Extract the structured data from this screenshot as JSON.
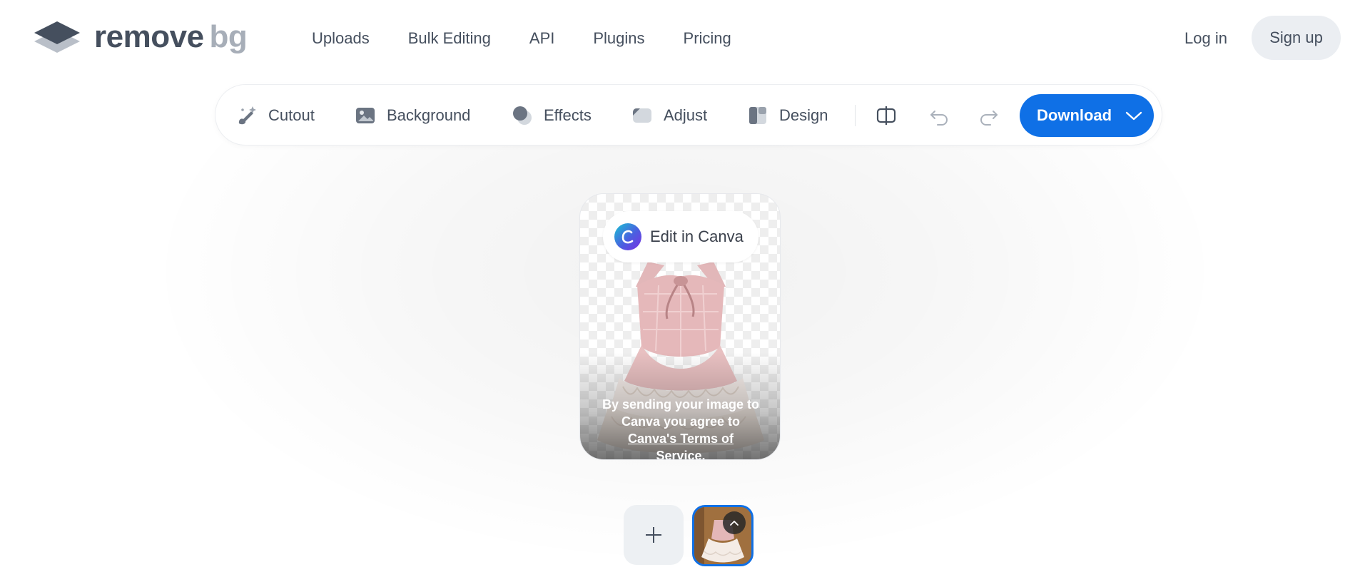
{
  "brand": {
    "word1": "remove",
    "word2": "bg"
  },
  "nav": {
    "items": [
      {
        "label": "Uploads"
      },
      {
        "label": "Bulk Editing"
      },
      {
        "label": "API"
      },
      {
        "label": "Plugins"
      },
      {
        "label": "Pricing"
      }
    ],
    "login_label": "Log in",
    "signup_label": "Sign up"
  },
  "toolbar": {
    "tools": [
      {
        "label": "Cutout",
        "icon": "brush-sparkle-icon"
      },
      {
        "label": "Background",
        "icon": "image-icon"
      },
      {
        "label": "Effects",
        "icon": "effects-circles-icon"
      },
      {
        "label": "Adjust",
        "icon": "adjust-icon"
      },
      {
        "label": "Design",
        "icon": "design-layout-icon"
      }
    ],
    "compare_icon": "compare-icon",
    "undo_icon": "undo-icon",
    "redo_icon": "redo-icon",
    "download_label": "Download",
    "download_icon": "chevron-down-icon"
  },
  "editor": {
    "canva_button_label": "Edit in Canva",
    "terms_text_1": "By sending your image to Canva you agree to",
    "terms_link": "Canva's Terms of",
    "terms_text_2": "Service."
  },
  "colors": {
    "accent": "#0f70e6",
    "text": "#454f5e",
    "logo_light": "#a7aeb8",
    "signup_bg": "#ebeef2"
  },
  "thumbnails": {
    "add_icon": "plus-icon",
    "selected_icon": "chevron-up-icon"
  }
}
